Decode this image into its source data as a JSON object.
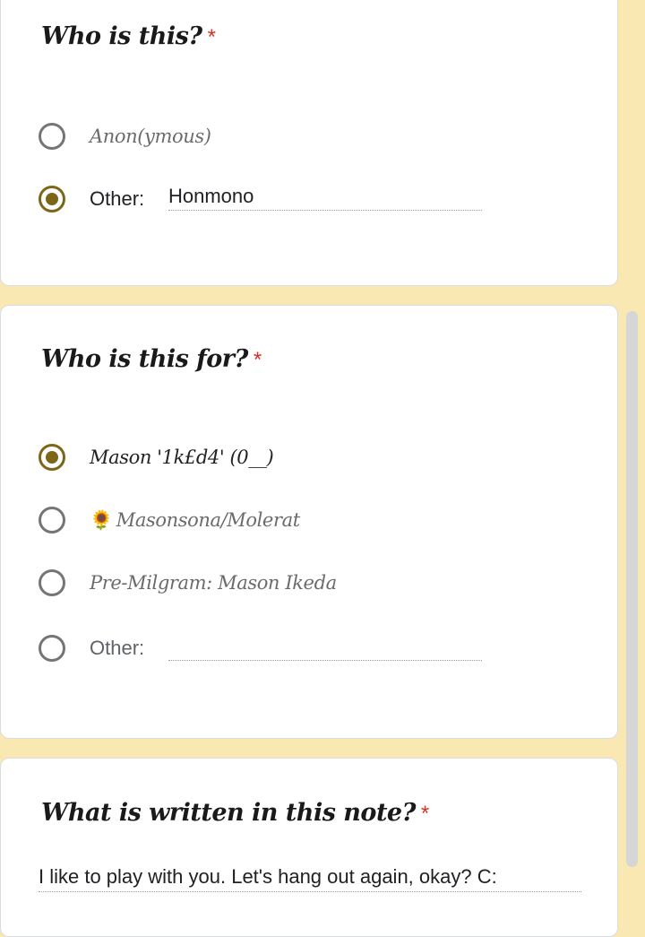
{
  "questions": [
    {
      "title": "Who is this?",
      "required_mark": "*",
      "options": [
        {
          "label": "Anon(ymous)",
          "selected": false
        },
        {
          "label": "Other:",
          "selected": true,
          "other_value": "Honmono"
        }
      ]
    },
    {
      "title": "Who is this for?",
      "required_mark": "*",
      "options": [
        {
          "label": "Mason '1k£d4' (0__)",
          "selected": true
        },
        {
          "icon": "🌻",
          "label": "Masonsona/Molerat",
          "selected": false
        },
        {
          "label": "Pre-Milgram: Mason Ikeda",
          "selected": false
        },
        {
          "label": "Other:",
          "selected": false,
          "other_value": ""
        }
      ]
    },
    {
      "title": "What is written in this note?",
      "required_mark": "*",
      "answer": "I like to play with you. Let's hang out again, okay? C:"
    }
  ],
  "colors": {
    "page_background": "#f9e8b1",
    "accent": "#7d6618",
    "required": "#d93025"
  }
}
